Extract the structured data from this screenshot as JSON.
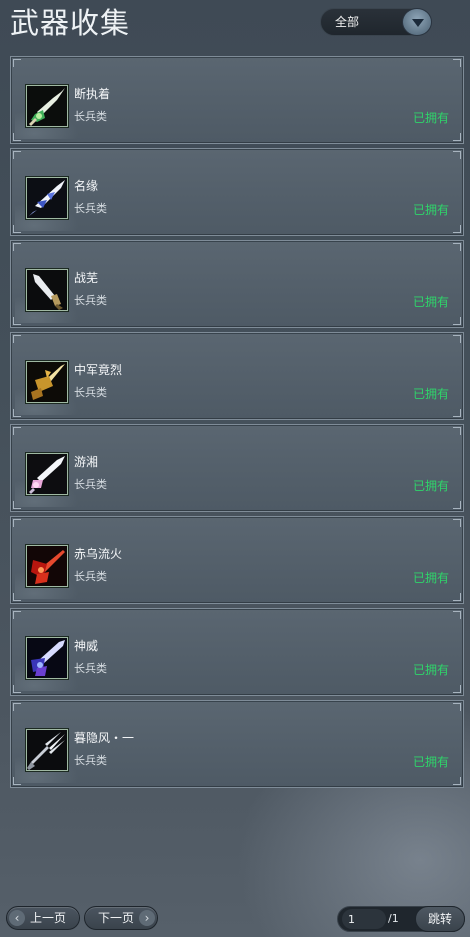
{
  "header": {
    "title": "武器收集",
    "filter": {
      "selected": "全部"
    }
  },
  "weapons": [
    {
      "name": "断执着",
      "category": "长兵类",
      "status": "已拥有",
      "icon": "weapon-icon-green-jade"
    },
    {
      "name": "名缘",
      "category": "长兵类",
      "status": "已拥有",
      "icon": "weapon-icon-blue-white"
    },
    {
      "name": "战芜",
      "category": "长兵类",
      "status": "已拥有",
      "icon": "weapon-icon-silver"
    },
    {
      "name": "中军竟烈",
      "category": "长兵类",
      "status": "已拥有",
      "icon": "weapon-icon-gold"
    },
    {
      "name": "游湘",
      "category": "长兵类",
      "status": "已拥有",
      "icon": "weapon-icon-pink-white"
    },
    {
      "name": "赤乌流火",
      "category": "长兵类",
      "status": "已拥有",
      "icon": "weapon-icon-red"
    },
    {
      "name": "神威",
      "category": "长兵类",
      "status": "已拥有",
      "icon": "weapon-icon-purple-blue"
    },
    {
      "name": "暮隐风・一",
      "category": "长兵类",
      "status": "已拥有",
      "icon": "weapon-icon-silver-trident"
    }
  ],
  "pagination": {
    "prev_label": "上一页",
    "next_label": "下一页",
    "current_page": "1",
    "total_pages": "/1",
    "jump_label": "跳转"
  },
  "colors": {
    "owned_status": "#2fd46a",
    "card_background": "#55616c",
    "page_background": "#434e58"
  }
}
